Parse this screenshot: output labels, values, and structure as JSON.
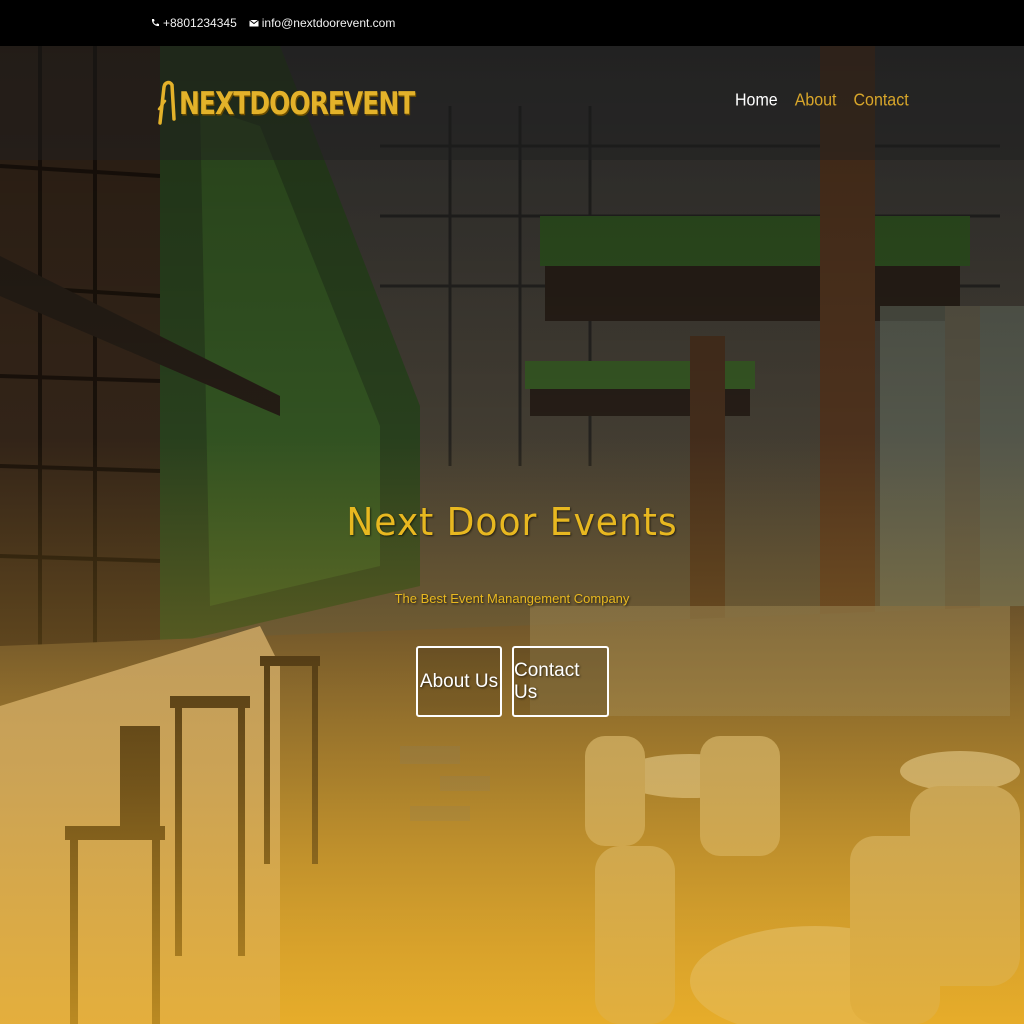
{
  "topbar": {
    "phone": "+8801234345",
    "email": "info@nextdoorevent.com"
  },
  "header": {
    "logo_text": "NEXTDOOREVENT",
    "nav": [
      {
        "label": "Home",
        "active": true
      },
      {
        "label": "About",
        "active": false
      },
      {
        "label": "Contact",
        "active": false
      }
    ]
  },
  "hero": {
    "title": "Next Door Events",
    "subtitle": "The Best Event Manangement Company",
    "buttons": [
      {
        "label": "About Us"
      },
      {
        "label": "Contact Us"
      }
    ]
  },
  "colors": {
    "brand_gold": "#e3b22a",
    "nav_gold": "#d8a62a",
    "topbar_bg": "#000000"
  }
}
